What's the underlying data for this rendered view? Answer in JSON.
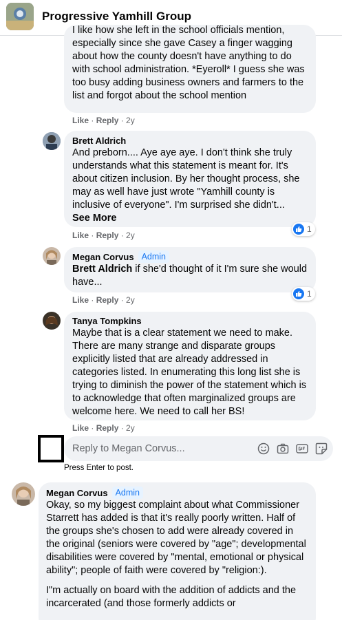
{
  "header": {
    "group_name": "Progressive Yamhill Group"
  },
  "comments": [
    {
      "text": "I like how she left in the school officials mention, especially since she gave Casey a finger wagging about how the county doesn't have anything to do with school administration. *Eyeroll* I guess she was too busy adding business owners and farmers to the list and forgot about the school mention",
      "like": "Like",
      "reply": "Reply",
      "time": "2y"
    },
    {
      "author": "Brett Aldrich",
      "text": "And preborn.... Aye aye aye. I don't think she truly understands what this statement is meant for. It's about citizen inclusion. By her thought process, she may as well have just wrote \"Yamhill county is inclusive of everyone\". I'm surprised she didn't...",
      "see_more": "See More",
      "like": "Like",
      "reply": "Reply",
      "time": "2y",
      "reaction_count": "1"
    },
    {
      "author": "Megan Corvus",
      "badge": "Admin",
      "mention": "Brett Aldrich",
      "text": " if she'd thought of it I'm sure she would have...",
      "like": "Like",
      "reply": "Reply",
      "time": "2y",
      "reaction_count": "1"
    },
    {
      "author": "Tanya Tompkins",
      "text": "Maybe that is a clear statement we need to make. There are many strange and disparate groups explicitly listed that are already addressed in categories listed. In enumerating this long list she is trying to diminish the power of the statement which is to acknowledge that often marginalized groups are welcome here. We need to call her BS!",
      "like": "Like",
      "reply": "Reply",
      "time": "2y"
    }
  ],
  "reply_box": {
    "placeholder": "Reply to Megan Corvus...",
    "hint": "Press Enter to post."
  },
  "bottom_comment": {
    "author": "Megan Corvus",
    "badge": "Admin",
    "paragraph1": "Okay, so my biggest complaint about what Commissioner Starrett has added is that it's really poorly written. Half of the groups she's chosen to add were already covered in the original (seniors were covered by \"age\"; developmental disabilities were covered by \"mental, emotional or physical ability\"; people of faith were covered by \"religion:).",
    "paragraph2": "I\"m actually on board with the addition of addicts and the incarcerated (and those formerly addicts or"
  },
  "icons": [
    "emoji-icon",
    "camera-icon",
    "gif-icon",
    "sticker-icon",
    "like-reaction-icon"
  ],
  "colors": {
    "accent": "#1877f2",
    "bubble": "#f0f2f5",
    "meta": "#65676b"
  }
}
